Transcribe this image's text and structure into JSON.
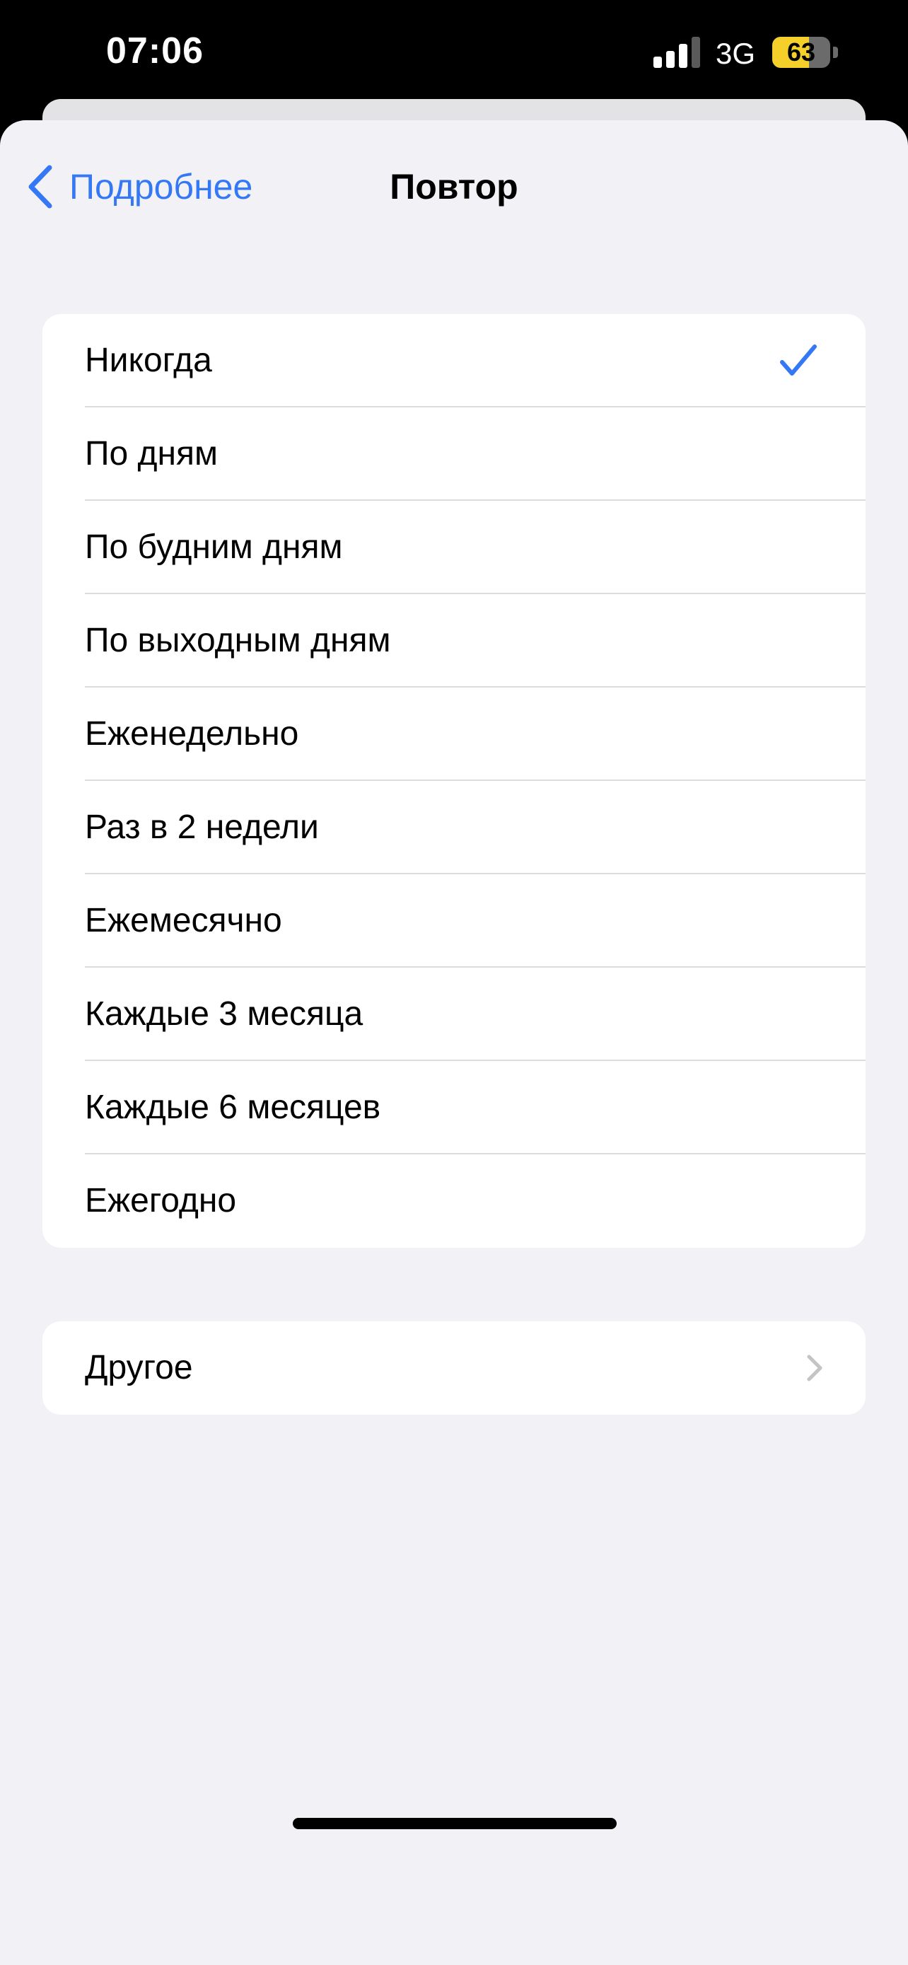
{
  "status_bar": {
    "time": "07:06",
    "network": "3G",
    "battery_level": "63",
    "battery_percent": 63,
    "signal_icon": "cellular-signal-icon",
    "battery_icon": "battery-icon"
  },
  "nav": {
    "back_label": "Подробнее",
    "back_icon": "chevron-left-icon",
    "title": "Повтор"
  },
  "options": [
    {
      "label": "Никогда",
      "selected": true
    },
    {
      "label": "По дням",
      "selected": false
    },
    {
      "label": "По будним дням",
      "selected": false
    },
    {
      "label": "По выходным дням",
      "selected": false
    },
    {
      "label": "Еженедельно",
      "selected": false
    },
    {
      "label": "Раз в 2 недели",
      "selected": false
    },
    {
      "label": "Ежемесячно",
      "selected": false
    },
    {
      "label": "Каждые 3 месяца",
      "selected": false
    },
    {
      "label": "Каждые 6 месяцев",
      "selected": false
    },
    {
      "label": "Ежегодно",
      "selected": false
    }
  ],
  "other": {
    "label": "Другое",
    "icon": "chevron-right-icon"
  },
  "colors": {
    "accent": "#3478f6",
    "background": "#f2f1f6",
    "battery": "#f5d02a"
  }
}
